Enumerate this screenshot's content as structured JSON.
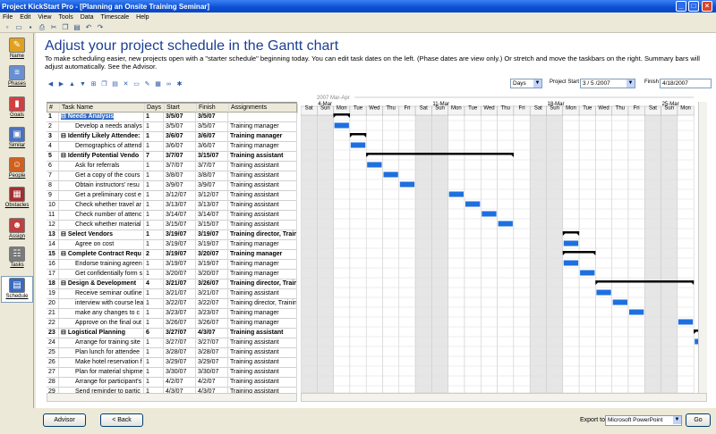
{
  "window": {
    "title": "Project KickStart Pro - [Planning an Onsite Training Seminar]",
    "menus": [
      "File",
      "Edit",
      "View",
      "Tools",
      "Data",
      "Timescale",
      "Help"
    ]
  },
  "sidebar": {
    "items": [
      {
        "label": "Name",
        "icon": "pencil-icon",
        "color": "#e0a020"
      },
      {
        "label": "Phases",
        "icon": "phases-icon",
        "color": "#6a8fd0"
      },
      {
        "label": "Goals",
        "icon": "chart-icon",
        "color": "#d04040"
      },
      {
        "label": "Similar",
        "icon": "similar-icon",
        "color": "#4a70c0"
      },
      {
        "label": "People",
        "icon": "people-icon",
        "color": "#d06020"
      },
      {
        "label": "Obstacles",
        "icon": "obstacle-icon",
        "color": "#a03030"
      },
      {
        "label": "Assign",
        "icon": "assign-icon",
        "color": "#c04040"
      },
      {
        "label": "Tasks",
        "icon": "tasks-icon",
        "color": "#7a7a7a"
      },
      {
        "label": "Schedule",
        "icon": "schedule-icon",
        "color": "#3a6ac0"
      }
    ]
  },
  "main": {
    "heading": "Adjust your project schedule in the Gantt chart",
    "instructions": "To make scheduling easier, new projects open with a \"starter schedule\" beginning today. You can edit task dates on the left. (Phase dates are view only.) Or stretch and move the taskbars on the right. Summary bars will adjust automatically. See the Advisor.",
    "scale": "Days",
    "project_start_label": "Project Start",
    "project_start": "3 / 5 /2007",
    "finish_label": "Finish",
    "finish": "4/18/2007"
  },
  "table": {
    "columns": [
      "#",
      "Task Name",
      "Days",
      "Start",
      "Finish",
      "Assignments"
    ],
    "rows": [
      {
        "n": "1",
        "name": "Needs Analysis",
        "days": "1",
        "start": "3/5/07",
        "finish": "3/5/07",
        "assign": "",
        "sum": true
      },
      {
        "n": "2",
        "name": "Develop a needs analys",
        "days": "1",
        "start": "3/5/07",
        "finish": "3/5/07",
        "assign": "Training manager",
        "sum": false
      },
      {
        "n": "3",
        "name": "Identify Likely Attendee:",
        "days": "1",
        "start": "3/6/07",
        "finish": "3/6/07",
        "assign": "Training manager",
        "sum": true
      },
      {
        "n": "4",
        "name": "Demographics of attend",
        "days": "1",
        "start": "3/6/07",
        "finish": "3/6/07",
        "assign": "Training manager",
        "sum": false
      },
      {
        "n": "5",
        "name": "Identify Potential Vendo",
        "days": "7",
        "start": "3/7/07",
        "finish": "3/15/07",
        "assign": "Training assistant",
        "sum": true
      },
      {
        "n": "6",
        "name": "Ask for referrals",
        "days": "1",
        "start": "3/7/07",
        "finish": "3/7/07",
        "assign": "Training assistant",
        "sum": false
      },
      {
        "n": "7",
        "name": "Get a copy of the cours",
        "days": "1",
        "start": "3/8/07",
        "finish": "3/8/07",
        "assign": "Training assistant",
        "sum": false
      },
      {
        "n": "8",
        "name": "Obtain instructors' resu",
        "days": "1",
        "start": "3/9/07",
        "finish": "3/9/07",
        "assign": "Training assistant",
        "sum": false
      },
      {
        "n": "9",
        "name": "Get a preliminary cost e",
        "days": "1",
        "start": "3/12/07",
        "finish": "3/12/07",
        "assign": "Training assistant",
        "sum": false
      },
      {
        "n": "10",
        "name": "Check whether travel ar",
        "days": "1",
        "start": "3/13/07",
        "finish": "3/13/07",
        "assign": "Training assistant",
        "sum": false
      },
      {
        "n": "11",
        "name": "Check number of attenc",
        "days": "1",
        "start": "3/14/07",
        "finish": "3/14/07",
        "assign": "Training assistant",
        "sum": false
      },
      {
        "n": "12",
        "name": "Check whether material",
        "days": "1",
        "start": "3/15/07",
        "finish": "3/15/07",
        "assign": "Training assistant",
        "sum": false
      },
      {
        "n": "13",
        "name": "Select Vendors",
        "days": "1",
        "start": "3/19/07",
        "finish": "3/19/07",
        "assign": "Training director, Traini",
        "sum": true
      },
      {
        "n": "14",
        "name": "Agree on cost",
        "days": "1",
        "start": "3/19/07",
        "finish": "3/19/07",
        "assign": "Training manager",
        "sum": false
      },
      {
        "n": "15",
        "name": "Complete Contract Requ",
        "days": "2",
        "start": "3/19/07",
        "finish": "3/20/07",
        "assign": "Training manager",
        "sum": true
      },
      {
        "n": "16",
        "name": "Endorse training agreen",
        "days": "1",
        "start": "3/19/07",
        "finish": "3/19/07",
        "assign": "Training manager",
        "sum": false
      },
      {
        "n": "17",
        "name": "Get confidentially form s",
        "days": "1",
        "start": "3/20/07",
        "finish": "3/20/07",
        "assign": "Training manager",
        "sum": false
      },
      {
        "n": "18",
        "name": "Design & Development",
        "days": "4",
        "start": "3/21/07",
        "finish": "3/26/07",
        "assign": "Training director, Traini",
        "sum": true
      },
      {
        "n": "19",
        "name": "Receive seminar outline",
        "days": "1",
        "start": "3/21/07",
        "finish": "3/21/07",
        "assign": "Training assistant",
        "sum": false
      },
      {
        "n": "20",
        "name": "interview with course lea",
        "days": "1",
        "start": "3/22/07",
        "finish": "3/22/07",
        "assign": "Training director, Training",
        "sum": false
      },
      {
        "n": "21",
        "name": "make any changes to c",
        "days": "1",
        "start": "3/23/07",
        "finish": "3/23/07",
        "assign": "Training manager",
        "sum": false
      },
      {
        "n": "22",
        "name": "Approve on the final out",
        "days": "1",
        "start": "3/26/07",
        "finish": "3/26/07",
        "assign": "Training manager",
        "sum": false
      },
      {
        "n": "23",
        "name": "Logistical Planning",
        "days": "6",
        "start": "3/27/07",
        "finish": "4/3/07",
        "assign": "Training assistant",
        "sum": true
      },
      {
        "n": "24",
        "name": "Arrange for training site",
        "days": "1",
        "start": "3/27/07",
        "finish": "3/27/07",
        "assign": "Training assistant",
        "sum": false
      },
      {
        "n": "25",
        "name": "Plan lunch for attendee",
        "days": "1",
        "start": "3/28/07",
        "finish": "3/28/07",
        "assign": "Training assistant",
        "sum": false
      },
      {
        "n": "26",
        "name": "Make hotel reservation f",
        "days": "1",
        "start": "3/29/07",
        "finish": "3/29/07",
        "assign": "Training assistant",
        "sum": false
      },
      {
        "n": "27",
        "name": "Plan for material shipme",
        "days": "1",
        "start": "3/30/07",
        "finish": "3/30/07",
        "assign": "Training assistant",
        "sum": false
      },
      {
        "n": "28",
        "name": "Arrange for participant's",
        "days": "1",
        "start": "4/2/07",
        "finish": "4/2/07",
        "assign": "Training assistant",
        "sum": false
      },
      {
        "n": "29",
        "name": "Send reminder to partic",
        "days": "1",
        "start": "4/3/07",
        "finish": "4/3/07",
        "assign": "Training assistant",
        "sum": false
      }
    ]
  },
  "gantt": {
    "period_label": "2007 Mar-Apr",
    "week_labels": [
      "4-Mar",
      "11-Mar",
      "18-Mar",
      "25-Mar"
    ],
    "day_labels": [
      "Sat",
      "Sun",
      "Mon",
      "Tue",
      "Wed",
      "Thu",
      "Fri",
      "Sat",
      "Sun",
      "Mon",
      "Tue",
      "Wed",
      "Thu",
      "Fri",
      "Sat",
      "Sun",
      "Mon",
      "Tue",
      "Wed",
      "Thu",
      "Fri",
      "Sat",
      "Sun",
      "Mon"
    ],
    "bar_color": "#1e6fe0",
    "summary_color": "#000000",
    "weekend_color": "#e6e6e6"
  },
  "bottom": {
    "advisor_label": "Advisor",
    "back_label": "< Back",
    "export_label": "Export to",
    "export_value": "Microsoft PowerPoint",
    "go_label": "Go"
  }
}
